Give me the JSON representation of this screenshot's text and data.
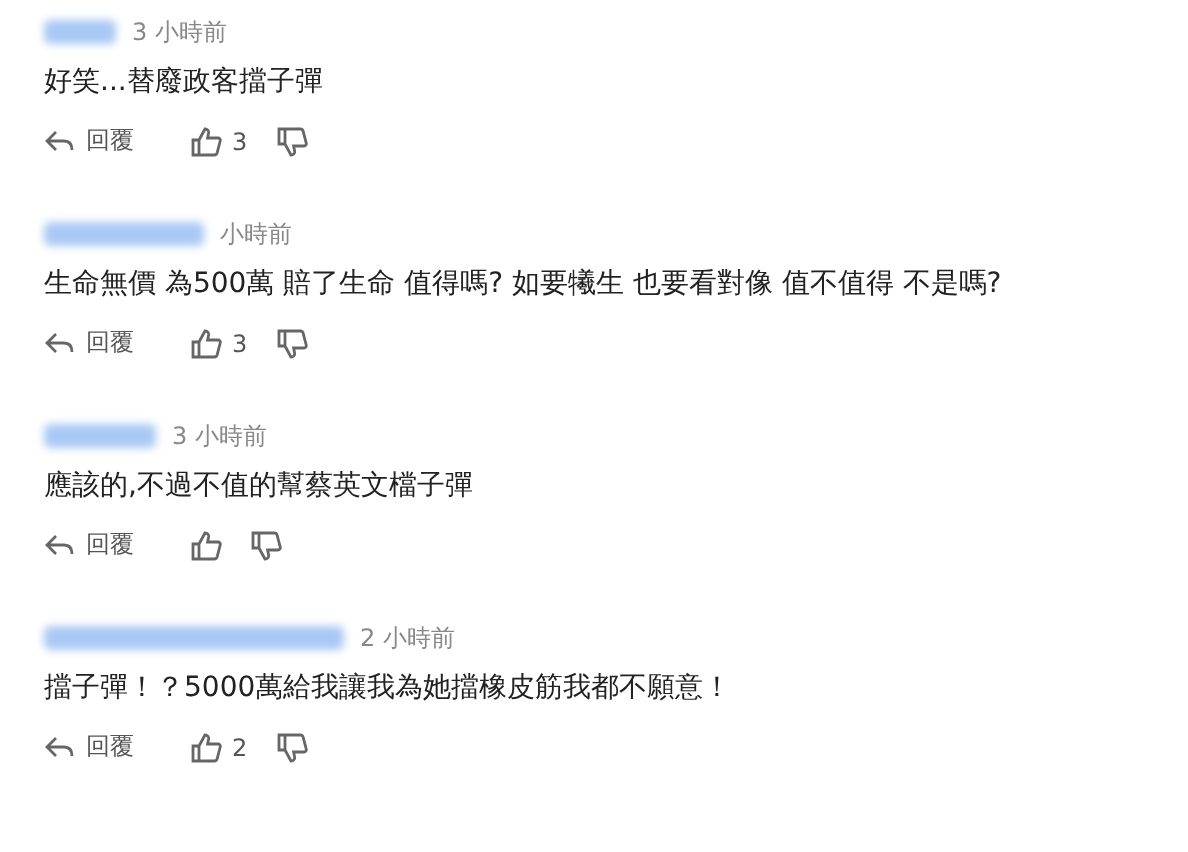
{
  "comments": [
    {
      "time": "3 小時前",
      "text": "好笑...替廢政客擋子彈",
      "reply": "回覆",
      "likes": "3"
    },
    {
      "time": "小時前",
      "text": "生命無價 為500萬 賠了生命 值得嗎? 如要犧生 也要看對像 值不值得 不是嗎?",
      "reply": "回覆",
      "likes": "3"
    },
    {
      "time": "3 小時前",
      "text": "應該的,不過不值的幫蔡英文檔子彈",
      "reply": "回覆"
    },
    {
      "time": "2 小時前",
      "text": "擋子彈！？5000萬給我讓我為她擋橡皮筋我都不願意！",
      "reply": "回覆",
      "likes": "2"
    }
  ]
}
